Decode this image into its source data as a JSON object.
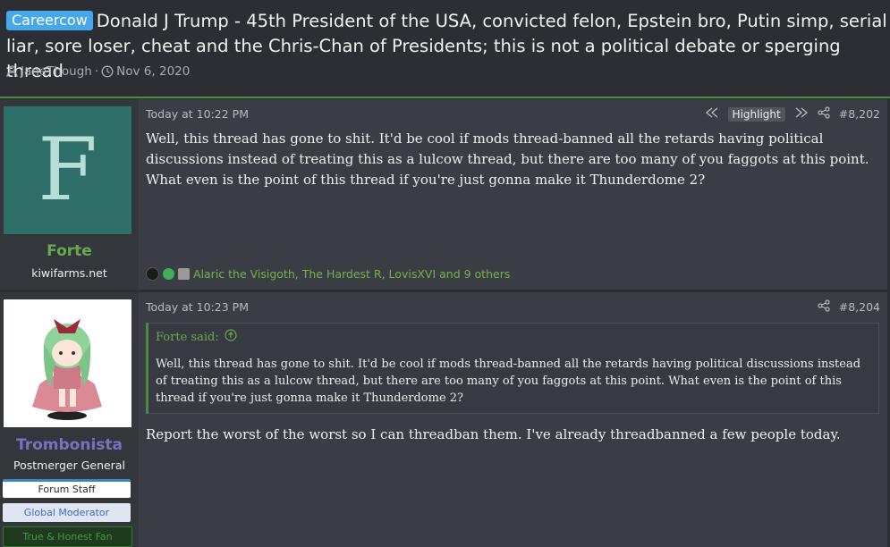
{
  "thread": {
    "prefix": "Careercow",
    "title": "Donald J Trump - 45th President of the USA, convicted felon, Epstein bro, Putin simp, serial liar, sore loser, cheat and the Chris-Chan of Presidents; this is not a political debate or sperging thread",
    "author": "JaneThough",
    "date": "Nov 6, 2020",
    "separator": "·"
  },
  "posts": [
    {
      "avatar_letter": "F",
      "username": "Forte",
      "user_title": "kiwifarms.net",
      "timestamp": "Today at 10:22 PM",
      "highlight_label": "Highlight",
      "post_number": "#8,202",
      "body": "Well, this thread has gone to shit. It'd be cool if mods thread-banned all the retards having political discussions instead of treating this as a lulcow thread, but there are too many of you faggots at this point. What even is the point of this thread if you're just gonna make it Thunderdome 2?",
      "reactions_text": "Alaric the Visigoth, The Hardest R, LovisXVI and 9 others"
    },
    {
      "username": "Trombonista",
      "user_title": "Postmerger General",
      "badges": [
        "Forum Staff",
        "Global Moderator",
        "True & Honest Fan"
      ],
      "timestamp": "Today at 10:23 PM",
      "post_number": "#8,204",
      "quote_author": "Forte said:",
      "quote_body": "Well, this thread has gone to shit. It'd be cool if mods thread-banned all the retards having political discussions instead of treating this as a lulcow thread, but there are too many of you faggots at this point. What even is the point of this thread if you're just gonna make it Thunderdome 2?",
      "body": "Report the worst of the worst so I can threadban them. I've already threadbanned a few people today."
    }
  ],
  "colors": {
    "background": "#2b2f33",
    "post_background": "#3a3e44",
    "accent_green": "#4c8a3c",
    "prefix_blue": "#47a7eb",
    "username_green": "#6aa84f",
    "username_purple": "#7b6fc4"
  },
  "icons": {
    "author": "user-icon",
    "date": "clock-icon",
    "prev": "rewind-icon",
    "next": "fast-forward-icon",
    "share": "share-icon",
    "quote_jump": "arrow-up-circle-icon"
  }
}
